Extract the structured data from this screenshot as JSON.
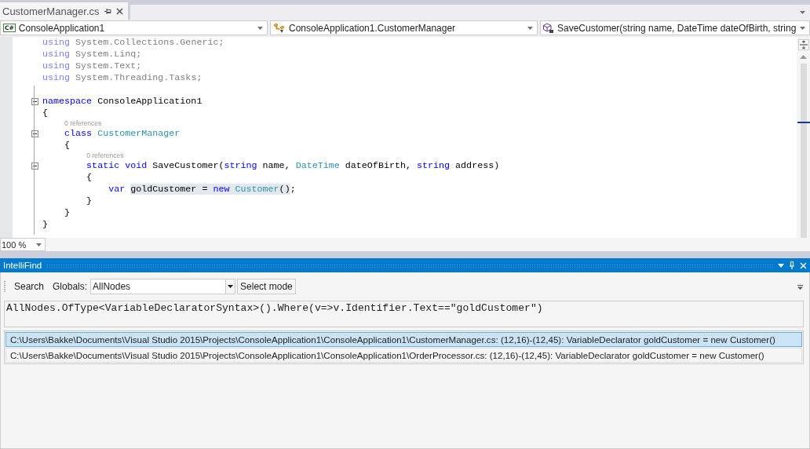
{
  "document_tab": {
    "title": "CustomerManager.cs"
  },
  "navigation_bar": [
    {
      "kind": "project",
      "icon_label": "C#",
      "text": "ConsoleApplication1"
    },
    {
      "kind": "class",
      "text": "ConsoleApplication1.CustomerManager"
    },
    {
      "kind": "method",
      "text": "SaveCustomer(string name, DateTime dateOfBirth, string"
    }
  ],
  "editor": {
    "lines": [
      {
        "kind": "code",
        "foldable": false,
        "tokens": [
          {
            "text": "using",
            "kind": "dimmed_keyword"
          },
          {
            "text": " System.Collections.Generic;",
            "kind": "dimmed"
          }
        ]
      },
      {
        "kind": "code",
        "foldable": false,
        "tokens": [
          {
            "text": "using",
            "kind": "dimmed_keyword"
          },
          {
            "text": " System.Linq;",
            "kind": "dimmed"
          }
        ]
      },
      {
        "kind": "code",
        "foldable": false,
        "tokens": [
          {
            "text": "using",
            "kind": "dimmed_keyword"
          },
          {
            "text": " System.Text;",
            "kind": "dimmed"
          }
        ]
      },
      {
        "kind": "code",
        "foldable": false,
        "tokens": [
          {
            "text": "using",
            "kind": "dimmed_keyword"
          },
          {
            "text": " System.Threading.Tasks;",
            "kind": "dimmed"
          }
        ]
      },
      {
        "kind": "blank"
      },
      {
        "kind": "code",
        "foldable": true,
        "tokens": [
          {
            "text": "namespace",
            "kind": "keyword"
          },
          {
            "text": " ConsoleApplication1",
            "kind": "plain"
          }
        ]
      },
      {
        "kind": "code",
        "foldable": false,
        "tokens": [
          {
            "text": "{",
            "kind": "plain"
          }
        ]
      },
      {
        "kind": "codelens",
        "text": "0 references"
      },
      {
        "kind": "code",
        "foldable": true,
        "tokens": [
          {
            "text": "    class ",
            "kind": "keyword"
          },
          {
            "text": "CustomerManager",
            "kind": "type"
          }
        ]
      },
      {
        "kind": "code",
        "foldable": false,
        "tokens": [
          {
            "text": "    {",
            "kind": "plain"
          }
        ]
      },
      {
        "kind": "codelens",
        "text": "0 references"
      },
      {
        "kind": "code",
        "foldable": true,
        "tokens": [
          {
            "text": "        static void",
            "kind": "keyword"
          },
          {
            "text": " SaveCustomer(",
            "kind": "plain"
          },
          {
            "text": "string",
            "kind": "keyword"
          },
          {
            "text": " name, ",
            "kind": "plain"
          },
          {
            "text": "DateTime",
            "kind": "type"
          },
          {
            "text": " dateOfBirth, ",
            "kind": "plain"
          },
          {
            "text": "string",
            "kind": "keyword"
          },
          {
            "text": " address)",
            "kind": "plain"
          }
        ]
      },
      {
        "kind": "code",
        "foldable": false,
        "tokens": [
          {
            "text": "        {",
            "kind": "plain"
          }
        ]
      },
      {
        "kind": "code",
        "foldable": false,
        "tokens": [
          {
            "text": "            var ",
            "kind": "keyword"
          },
          {
            "text": "goldCustomer = ",
            "kind": "plain",
            "highlighted": true
          },
          {
            "text": "new ",
            "kind": "keyword",
            "highlighted": true
          },
          {
            "text": "Customer",
            "kind": "type",
            "highlighted": true
          },
          {
            "text": "(",
            "kind": "plain",
            "highlighted": true
          },
          {
            "text": ")",
            "kind": "plain",
            "highlighted": true
          },
          {
            "text": ";",
            "kind": "plain"
          }
        ]
      },
      {
        "kind": "code",
        "foldable": false,
        "tokens": [
          {
            "text": "        }",
            "kind": "plain"
          }
        ]
      },
      {
        "kind": "code",
        "foldable": false,
        "tokens": [
          {
            "text": "    }",
            "kind": "plain"
          }
        ]
      },
      {
        "kind": "code",
        "foldable": false,
        "tokens": [
          {
            "text": "}",
            "kind": "plain"
          }
        ]
      }
    ],
    "zoom": "100 %"
  },
  "tool_window": {
    "title": "IntelliFind",
    "toolbar": {
      "search_button": "Search",
      "globals_label": "Globals:",
      "globals_value": "AllNodes",
      "select_mode_button": "Select mode"
    },
    "query": "AllNodes.OfType<VariableDeclaratorSyntax>().Where(v=>v.Identifier.Text==\"goldCustomer\")",
    "results": [
      {
        "text": "C:\\Users\\Bakke\\Documents\\Visual Studio 2015\\Projects\\ConsoleApplication1\\ConsoleApplication1\\CustomerManager.cs: (12,16)-(12,45): VariableDeclarator goldCustomer = new Customer()",
        "selected": true
      },
      {
        "text": "C:\\Users\\Bakke\\Documents\\Visual Studio 2015\\Projects\\ConsoleApplication1\\ConsoleApplication1\\OrderProcessor.cs: (12,16)-(12,45): VariableDeclarator goldCustomer = new Customer()",
        "selected": false
      }
    ]
  }
}
